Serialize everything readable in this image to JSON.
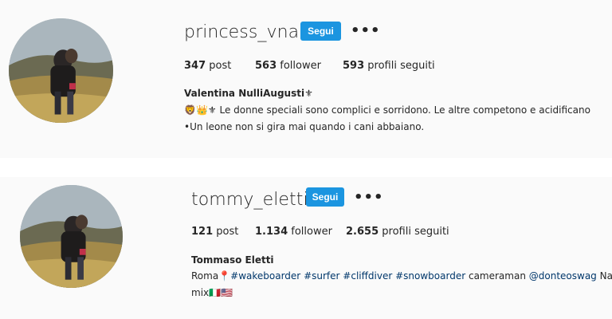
{
  "profiles": [
    {
      "username": "princess_vna",
      "follow_label": "Segui",
      "more_label": "•••",
      "posts": "347",
      "posts_label": "post",
      "followers": "563",
      "followers_label": "follower",
      "following": "593",
      "following_label": "profili seguiti",
      "full_name": "Valentina NulliAugusti⚜",
      "bio_line1_emoji": "🦁👑⚜",
      "bio_line1": "Le donne speciali sono complici e sorridono. Le altre competono e acidificano",
      "bio_line2": "•Un leone non si gira mai quando i cani abbaiano."
    },
    {
      "username": "tommy_eletti",
      "follow_label": "Segui",
      "more_label": "•••",
      "posts": "121",
      "posts_label": "post",
      "followers": "1.134",
      "followers_label": "follower",
      "following": "2.655",
      "following_label": "profili seguiti",
      "full_name": "Tommaso Eletti",
      "bio_city": "Roma",
      "bio_pin": "📍",
      "bio_tags": [
        "#wakeboarder",
        "#surfer",
        "#cliffdiver",
        "#snowboarder"
      ],
      "bio_role": "cameraman",
      "bio_mention": "@donteoswag",
      "bio_tail": "Native",
      "bio_line2": "mix🇮🇹🇺🇸"
    }
  ]
}
